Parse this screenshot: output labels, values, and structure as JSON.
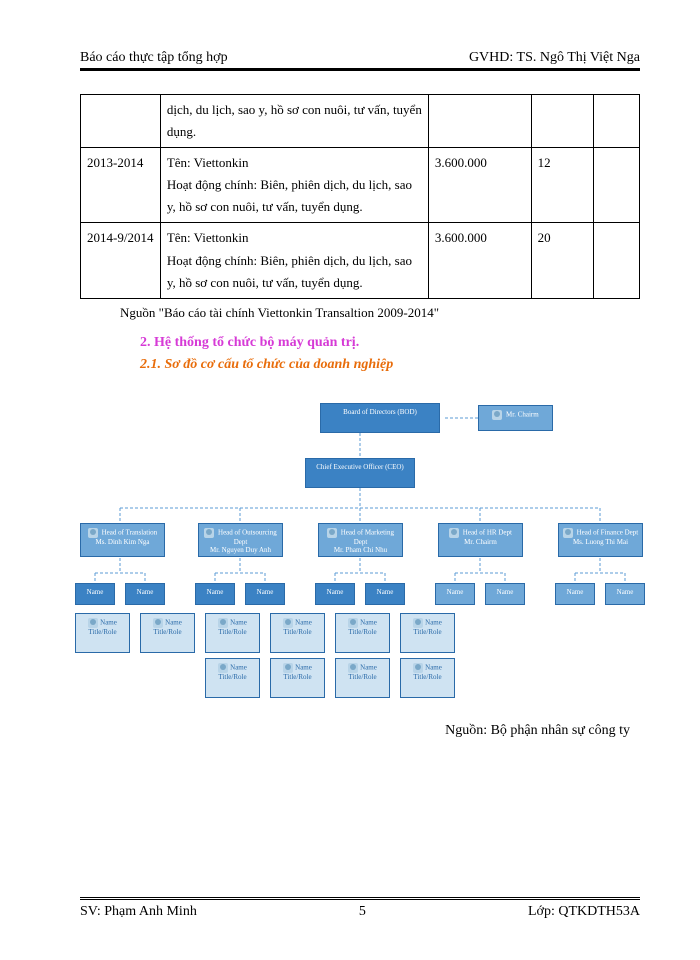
{
  "header": {
    "left": "Báo cáo thực tập tổng hợp",
    "right": "GVHD: TS. Ngô Thị Việt Nga"
  },
  "table": {
    "rows": [
      {
        "period": "",
        "desc": "dịch, du lịch, sao y, hồ sơ con nuôi, tư vấn, tuyển dụng.",
        "amount": "",
        "count": "",
        "extra": ""
      },
      {
        "period": "2013-2014",
        "desc": "Tên: Viettonkin\nHoạt động chính: Biên, phiên dịch, du lịch, sao y, hồ sơ con nuôi, tư vấn, tuyển dụng.",
        "amount": "3.600.000",
        "count": "12",
        "extra": ""
      },
      {
        "period": "2014-9/2014",
        "desc": "Tên: Viettonkin\nHoạt động chính: Biên, phiên dịch, du lịch, sao y, hồ sơ con nuôi, tư vấn, tuyển dụng.",
        "amount": "3.600.000",
        "count": "20",
        "extra": ""
      }
    ]
  },
  "source_line": "Nguồn \"Báo cáo tài chính Viettonkin Transaltion 2009-2014\"",
  "headings": {
    "h2": "2. Hệ thống tổ chức bộ máy quản trị.",
    "h21": "2.1. Sơ đồ cơ cấu tổ chức của doanh nghiệp"
  },
  "org": {
    "board": "Board of Directors (BOD)",
    "chairman": "Mr. Chairm",
    "ceo": "Chief Executive Officer (CEO)",
    "depts": [
      {
        "head": "Head of Translation",
        "name": "Ms. Dinh Kim Nga"
      },
      {
        "head": "Head of Outsourcing Dept",
        "name": "Mr. Nguyen Duy Anh"
      },
      {
        "head": "Head of Marketing Dept",
        "name": "Mr. Pham Chi Nhu"
      },
      {
        "head": "Head of HR Dept",
        "name": "Mr. Chairm"
      },
      {
        "head": "Head of Finance Dept",
        "name": "Ms. Luong Thi Mai"
      }
    ],
    "sub_label": "Name",
    "sub_role": "Title/Role"
  },
  "chart_source": "Nguồn: Bộ phận nhân sự công ty",
  "footer": {
    "left": "SV: Phạm Anh Minh",
    "center": "5",
    "right": "Lớp: QTKDTH53A"
  }
}
